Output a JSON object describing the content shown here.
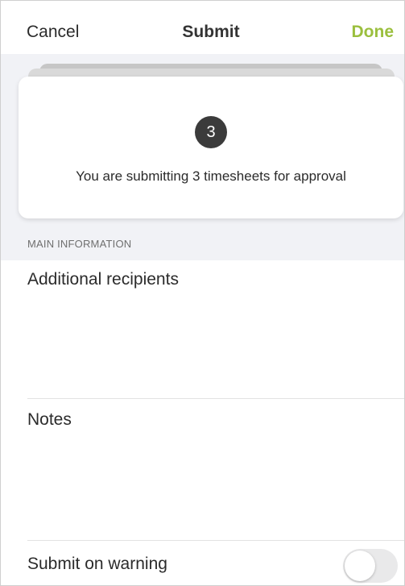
{
  "header": {
    "cancel_label": "Cancel",
    "title": "Submit",
    "done_label": "Done"
  },
  "summary_card": {
    "count": "3",
    "message": "You are submitting 3 timesheets for approval"
  },
  "section": {
    "title": "MAIN INFORMATION"
  },
  "fields": {
    "recipients_label": "Additional recipients",
    "notes_label": "Notes",
    "submit_on_warning_label": "Submit on warning",
    "submit_on_warning_enabled": false
  },
  "colors": {
    "accent": "#9bbf3e",
    "badge": "#3b3b3b",
    "section_bg": "#f1f2f6"
  }
}
